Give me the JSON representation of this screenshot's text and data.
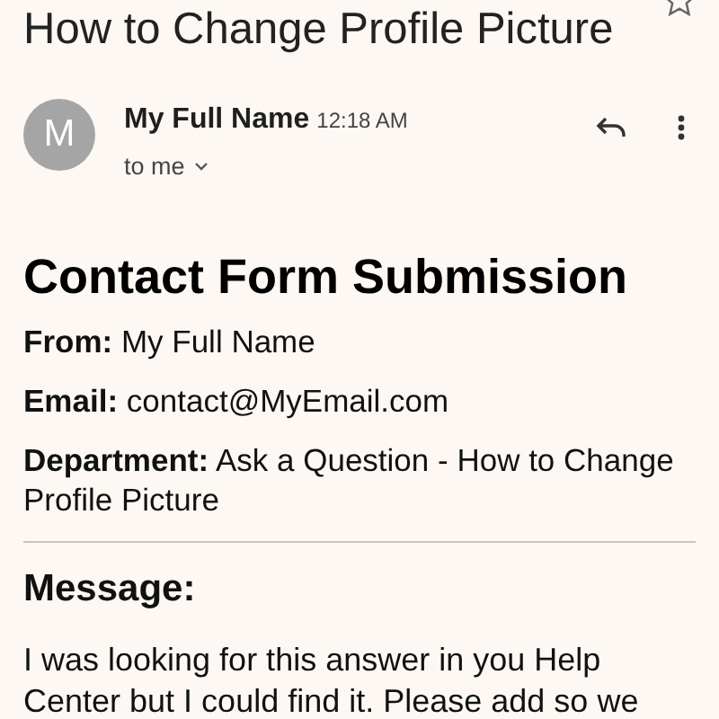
{
  "subject": "How to Change Profile Picture",
  "starred": false,
  "sender": {
    "initial": "M",
    "name": "My Full Name",
    "time": "12:18 AM",
    "recipient": "to me"
  },
  "body": {
    "heading": "Contact Form Submission",
    "fields": [
      "**From:** My Full Name",
      "**Email:** contact@MyEmail.com",
      "**Department:** Ask a Question - How to Change Profile Picture"
    ],
    "message_heading": "Message:",
    "message": "I was looking for this answer in you Help Center but I could find it. Please add so we"
  }
}
